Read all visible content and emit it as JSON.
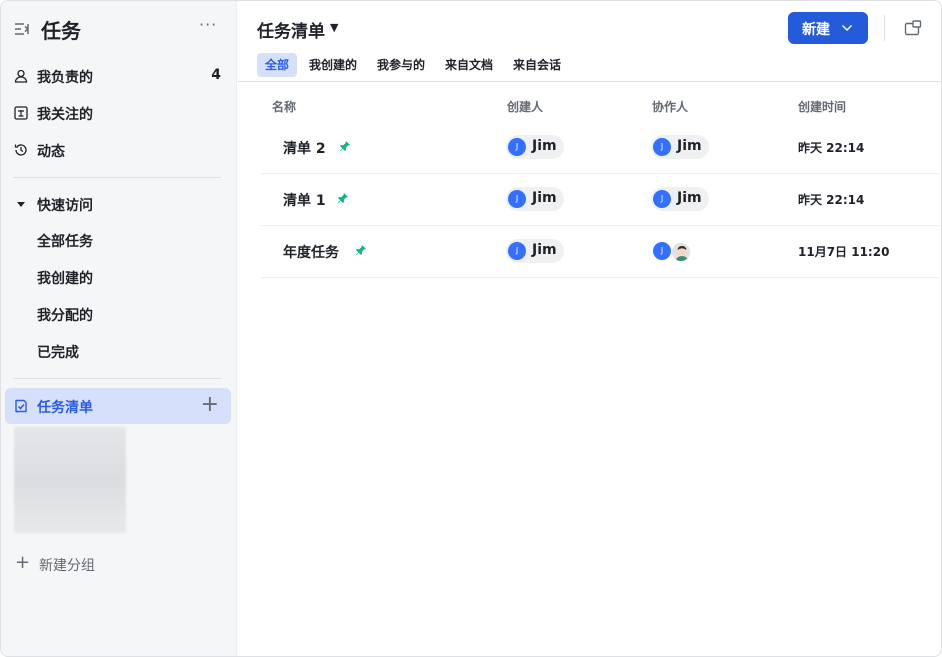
{
  "sidebar": {
    "title": "任务",
    "more": "···",
    "items": [
      {
        "label": "我负责的",
        "count": "4"
      },
      {
        "label": "我关注的"
      },
      {
        "label": "动态"
      }
    ],
    "quick_access": {
      "label": "快速访问",
      "items": [
        "全部任务",
        "我创建的",
        "我分配的",
        "已完成"
      ]
    },
    "task_list": {
      "label": "任务清单",
      "add": "+"
    },
    "new_group": {
      "plus": "+",
      "label": "新建分组"
    }
  },
  "main": {
    "title": "任务清单",
    "caret": "▼",
    "new_button": "新建",
    "tabs": [
      "全部",
      "我创建的",
      "我参与的",
      "来自文档",
      "来自会话"
    ],
    "active_tab": "全部",
    "columns": [
      "名称",
      "创建人",
      "协作人",
      "创建时间"
    ],
    "rows": [
      {
        "name": "清单 2",
        "creator": "Jim",
        "creator_initial": "J",
        "collaborator": "Jim",
        "collaborator_initial": "J",
        "time": "昨天 22:14"
      },
      {
        "name": "清单 1",
        "creator": "Jim",
        "creator_initial": "J",
        "collaborator": "Jim",
        "collaborator_initial": "J",
        "time": "昨天 22:14"
      },
      {
        "name": "年度任务",
        "creator": "Jim",
        "creator_initial": "J",
        "collaborator_initial": "J",
        "time": "11月7日 11:20"
      }
    ]
  },
  "colors": {
    "accent": "#245bdb",
    "active_bg": "#d6e0fa",
    "active_text": "#2b5ce6",
    "pin": "#14b38a",
    "avatar": "#3370ff"
  }
}
